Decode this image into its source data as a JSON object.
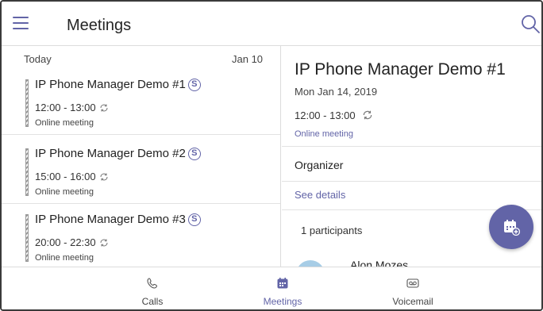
{
  "header": {
    "title": "Meetings",
    "menu_icon": "hamburger-menu-icon",
    "search_icon": "search-icon"
  },
  "list": {
    "day_label": "Today",
    "day_date": "Jan 10",
    "meetings": [
      {
        "title": "IP Phone Manager Demo #1",
        "skype_glyph": "S",
        "time": "12:00 - 13:00",
        "type": "Online meeting"
      },
      {
        "title": "IP Phone Manager Demo #2",
        "skype_glyph": "S",
        "time": "15:00 - 16:00",
        "type": "Online meeting"
      },
      {
        "title": "IP Phone Manager Demo #3",
        "skype_glyph": "S",
        "time": "20:00 - 22:30",
        "type": "Online meeting"
      }
    ]
  },
  "detail": {
    "title": "IP Phone Manager Demo #1",
    "date": "Mon Jan 14, 2019",
    "time": "12:00 - 13:00",
    "type": "Online meeting",
    "organizer_label": "Organizer",
    "see_details": "See details",
    "participants_label": "1 participants",
    "participant_name": "Alon Mozes"
  },
  "nav": {
    "items": [
      {
        "label": "Calls",
        "icon": "phone-icon"
      },
      {
        "label": "Meetings",
        "icon": "calendar-icon",
        "active": true
      },
      {
        "label": "Voicemail",
        "icon": "voicemail-icon"
      }
    ]
  },
  "colors": {
    "accent": "#6264a7",
    "divider": "#dcdcdc",
    "avatar": "#a7cde6"
  }
}
